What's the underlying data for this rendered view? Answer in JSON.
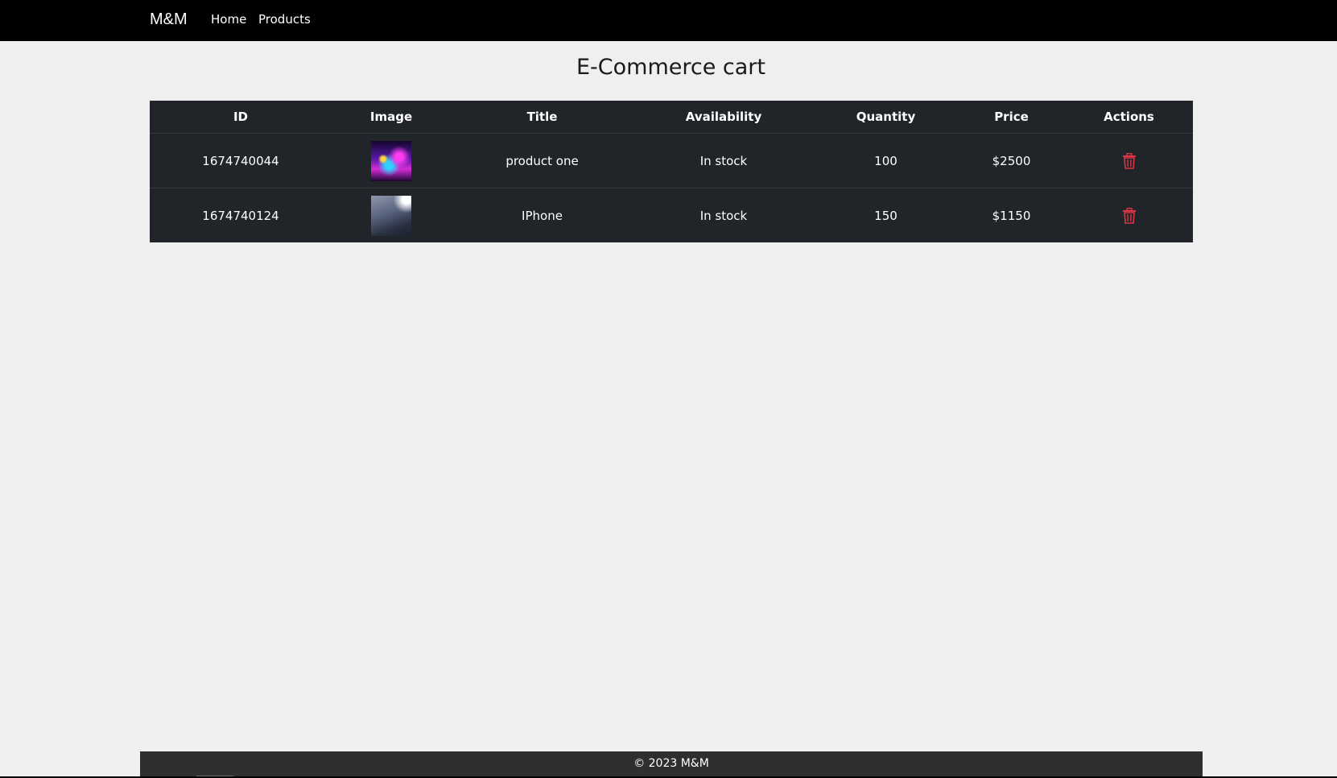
{
  "navbar": {
    "brand": "M&M",
    "links": [
      "Home",
      "Products"
    ]
  },
  "page": {
    "title": "E-Commerce cart"
  },
  "table": {
    "headers": [
      "ID",
      "Image",
      "Title",
      "Availability",
      "Quantity",
      "Price",
      "Actions"
    ],
    "rows": [
      {
        "id": "1674740044",
        "image": "product-image",
        "title": "product one",
        "availability": "In stock",
        "quantity": "100",
        "price": "$2500"
      },
      {
        "id": "1674740124",
        "image": "product-image",
        "title": "IPhone",
        "availability": "In stock",
        "quantity": "150",
        "price": "$1150"
      }
    ],
    "delete_icon": "trash-icon",
    "colors": {
      "table_bg": "#212529",
      "delete": "#dc3545"
    }
  },
  "footer": {
    "text": "© 2023 M&M"
  }
}
